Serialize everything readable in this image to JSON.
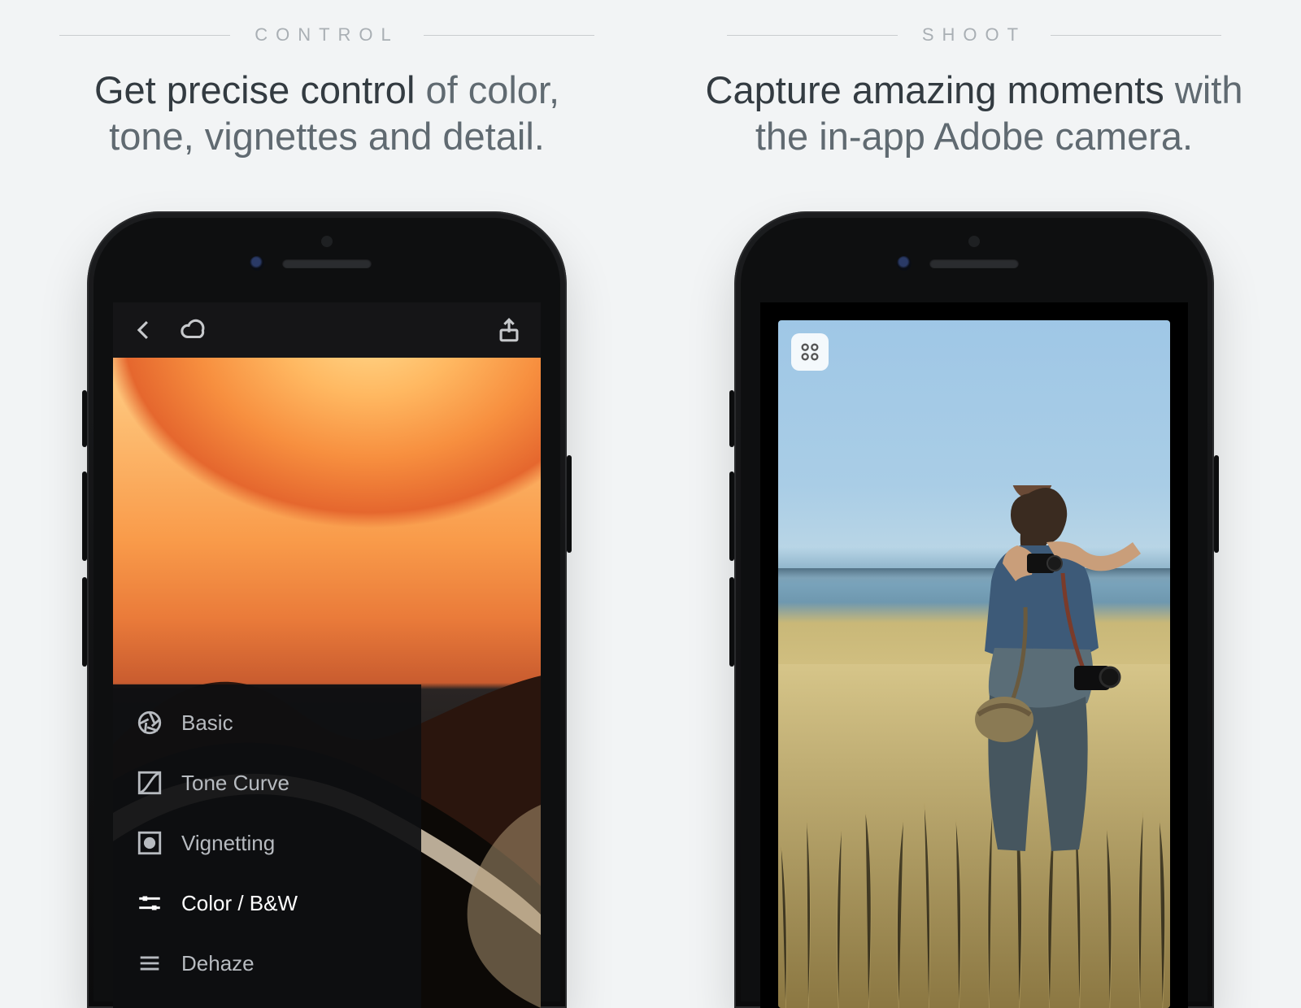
{
  "left": {
    "eyebrow": "CONTROL",
    "headline_bold": "Get precise control",
    "headline_rest": " of color, tone, vignettes and detail.",
    "tools": {
      "basic": "Basic",
      "tone_curve": "Tone Curve",
      "vignetting": "Vignetting",
      "color_bw": "Color / B&W",
      "dehaze": "Dehaze"
    }
  },
  "right": {
    "eyebrow": "SHOOT",
    "headline_bold": "Capture amazing moments",
    "headline_rest": " with the in-app Adobe camera."
  }
}
